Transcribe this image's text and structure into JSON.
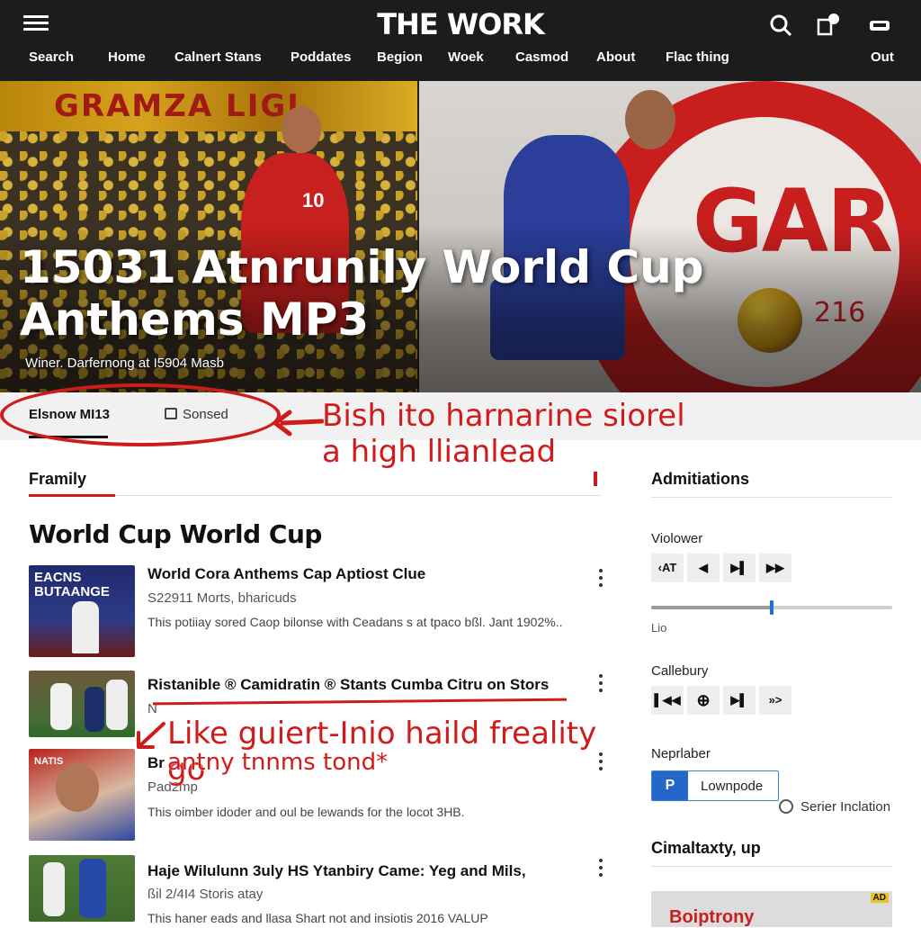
{
  "header": {
    "brand": "THE WORK",
    "nav": [
      "Search",
      "Home",
      "Calnert Stans",
      "Poddates",
      "Begion",
      "Woek",
      "Casmod",
      "About",
      "Flac thing",
      "Out"
    ]
  },
  "hero": {
    "title": "15031 Atnrunily World Cup Anthems MP3",
    "subtitle": "Winer. Darfernong at I5904 Masb",
    "banner_text": "GRAMZA LIGI",
    "right_brand": "GAR",
    "right_number": "216",
    "player_number": "10"
  },
  "tabs": {
    "active": "Elsnow MI13",
    "second": "Sonsed",
    "right": "Serier Inclation"
  },
  "annotations": {
    "top": "Bish ito harnarine siorel a high llianlead",
    "middle": "Like guiert-Inio haild freality go",
    "lower": "antny tnnms tond*"
  },
  "main": {
    "section_label": "Framily",
    "section_title": "World Cup World Cup",
    "items": [
      {
        "title": "World Cora Anthems Cap Aptiost Clue",
        "meta": "S22911 Morts, bharicuds",
        "desc": "This potiiay sored Caop bilonse with Ceadans s at tpaco bßl. Jant 1902%..",
        "thumb_text": "EACNS BUTAANGE"
      },
      {
        "title": "Ristanible ® Camidratin ® Stants Cumba Citru on Stors",
        "meta": "N",
        "desc": "",
        "thumb_text": ""
      },
      {
        "title": "Br",
        "meta": "Pad2mp",
        "desc": "This oimber idoder and oul be lewands for the locot 3HB.",
        "thumb_text": "NATIS"
      },
      {
        "title": "Haje Wilulunn 3uly HS Ytanbiry Came: Yeg and Mils,",
        "meta": "ßil 2/4I4 Storis atay",
        "desc": "This haner eads and llasa Shart not and insiotis 2016 VALUP",
        "thumb_text": ""
      }
    ]
  },
  "sidebar": {
    "heading": "Admitiations",
    "viewer_label": "Violower",
    "viewer_controls": [
      "‹AT",
      "◀",
      "▶▌",
      "▶▶"
    ],
    "slider_label": "Lio",
    "slider_level": 0.5,
    "gallery_label": "Callebury",
    "gallery_controls": [
      "▌◀◀",
      "⊕",
      "▶▌",
      "»>"
    ],
    "neprlaber_label": "Neprlaber",
    "toggle_p": "P",
    "toggle_label": "Lownpode",
    "bottom_heading": "Cimaltaxty, up",
    "ad_text": "Boiptrony",
    "ad_badge": "AD"
  }
}
